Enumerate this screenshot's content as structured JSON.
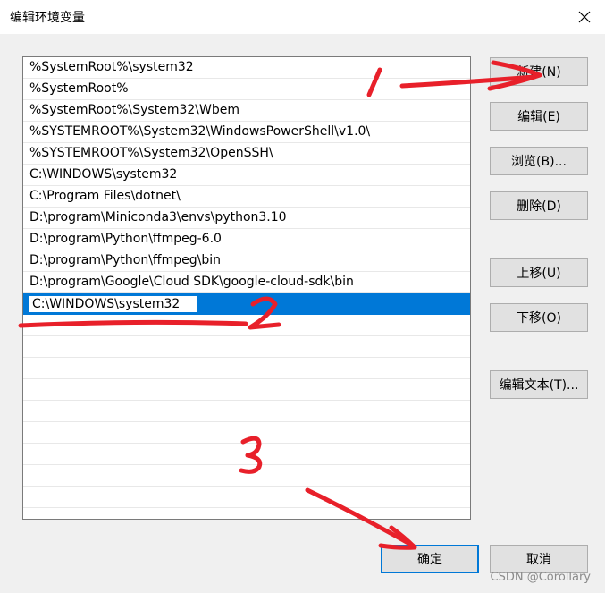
{
  "window": {
    "title": "编辑环境变量",
    "close_glyph": "✕"
  },
  "path_list": {
    "items": [
      "%SystemRoot%\\system32",
      "%SystemRoot%",
      "%SystemRoot%\\System32\\Wbem",
      "%SYSTEMROOT%\\System32\\WindowsPowerShell\\v1.0\\",
      "%SYSTEMROOT%\\System32\\OpenSSH\\",
      "C:\\WINDOWS\\system32",
      "C:\\Program Files\\dotnet\\",
      "D:\\program\\Miniconda3\\envs\\python3.10",
      "D:\\program\\Python\\ffmpeg-6.0",
      "D:\\program\\Python\\ffmpeg\\bin",
      "D:\\program\\Google\\Cloud SDK\\google-cloud-sdk\\bin"
    ],
    "editing_value": "C:\\WINDOWS\\system32",
    "selection_color": "#0078d7"
  },
  "buttons": {
    "new": "新建(N)",
    "edit": "编辑(E)",
    "browse": "浏览(B)...",
    "delete": "删除(D)",
    "move_up": "上移(U)",
    "move_down": "下移(O)",
    "edit_text": "编辑文本(T)...",
    "ok": "确定",
    "cancel": "取消"
  },
  "annotations": {
    "color": "#e8202a",
    "marks": [
      "1",
      "2",
      "3"
    ]
  },
  "watermark": "CSDN @Corollary"
}
